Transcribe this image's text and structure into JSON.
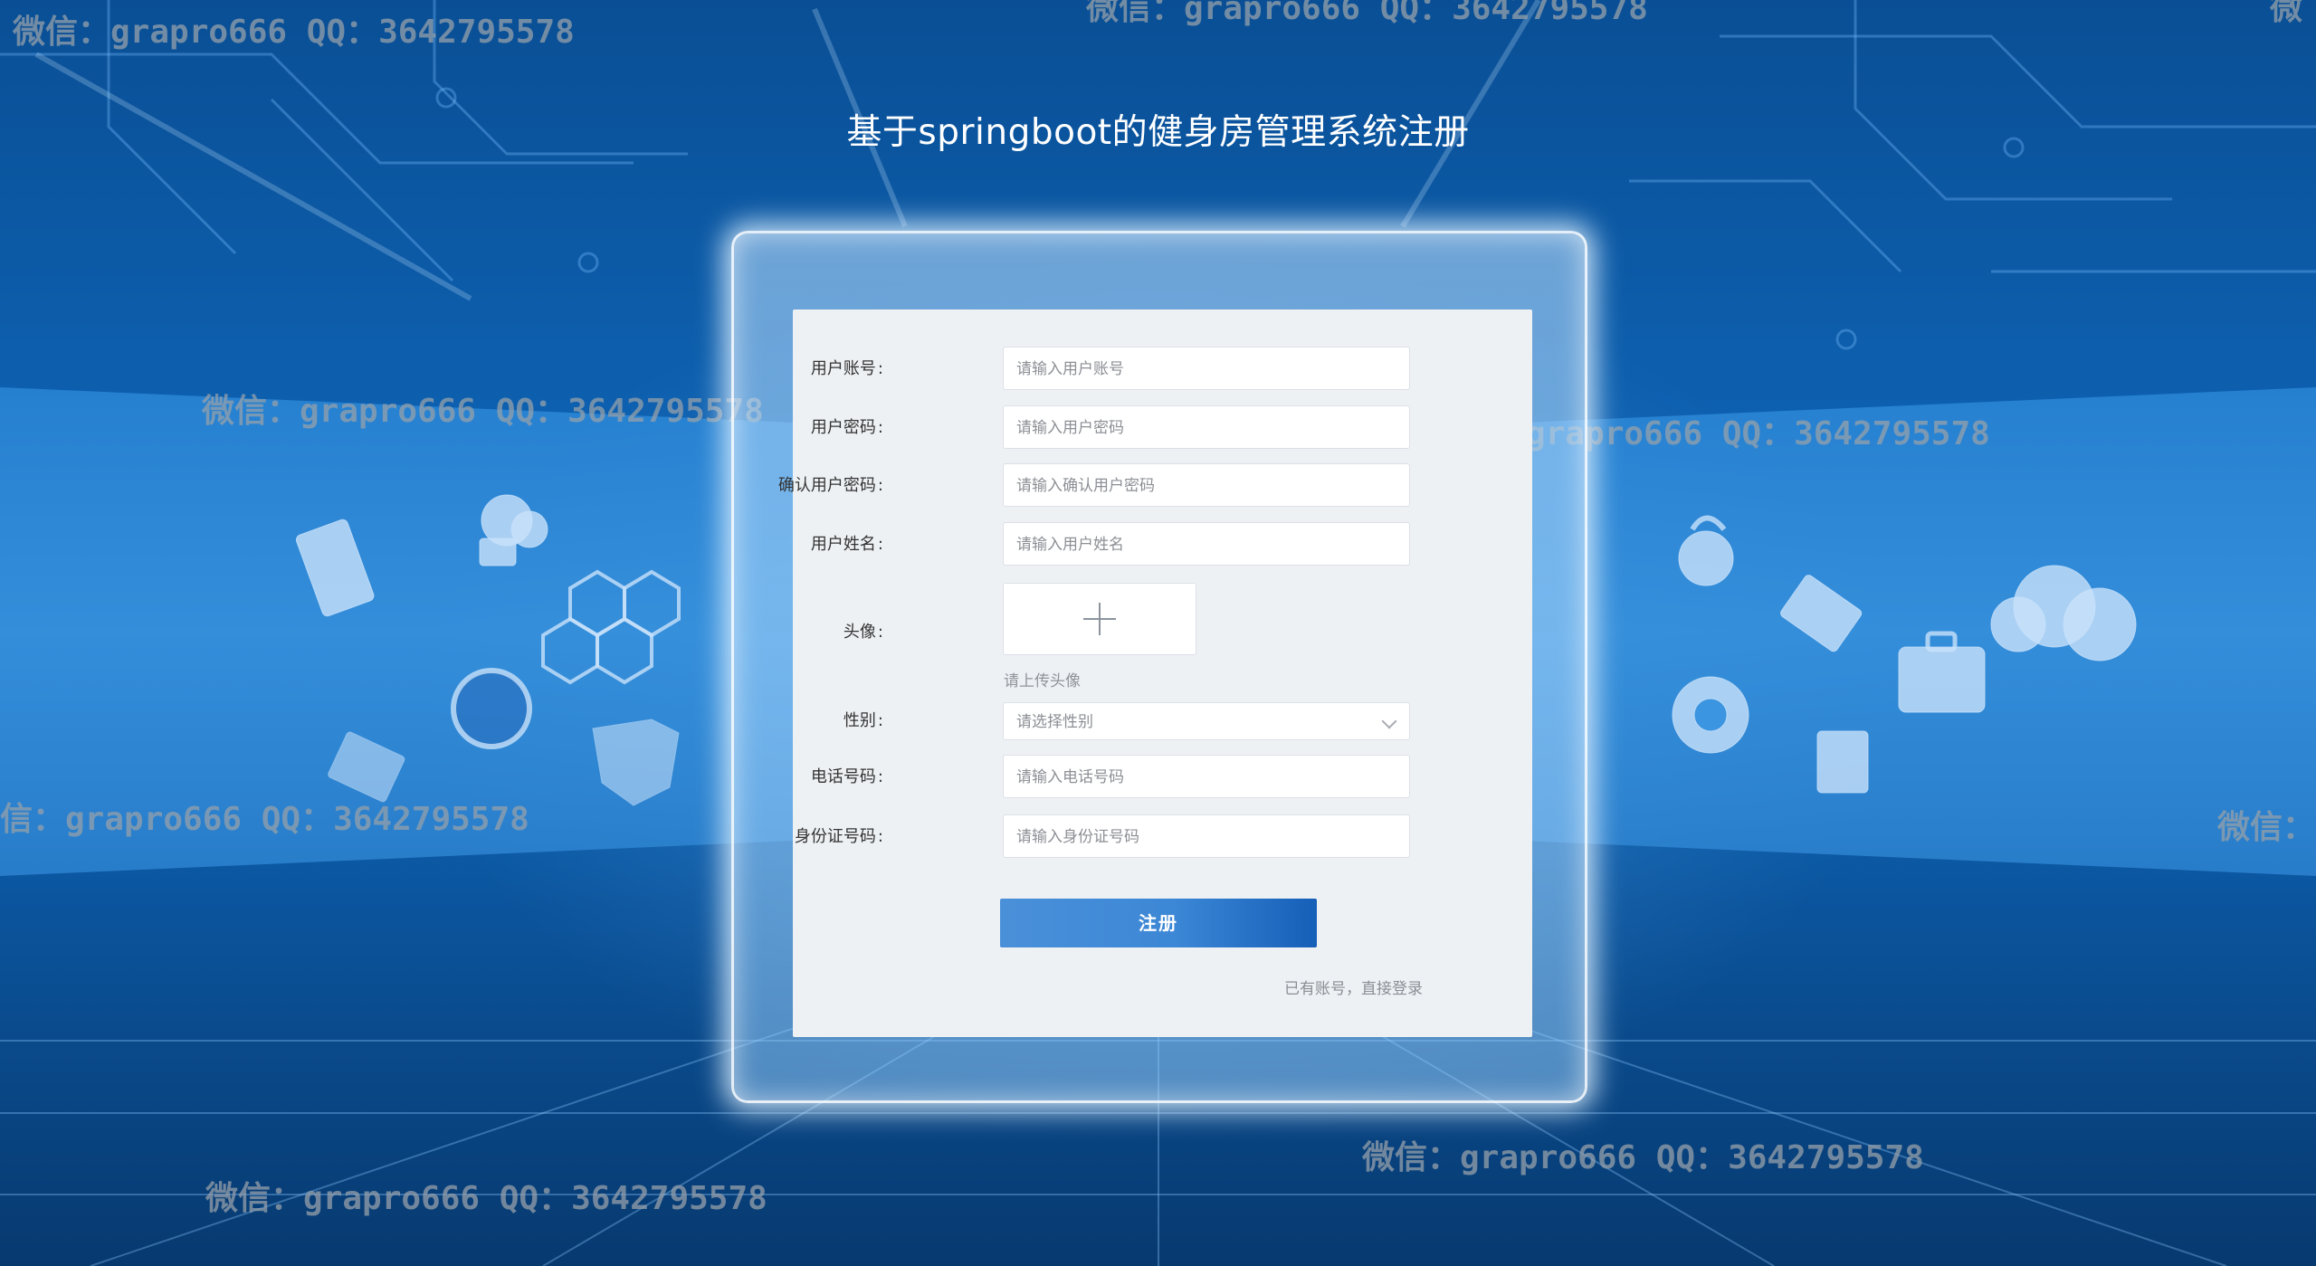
{
  "page": {
    "title": "基于springboot的健身房管理系统注册"
  },
  "form": {
    "fields": [
      {
        "label": "用户账号",
        "placeholder": "请输入用户账号",
        "type": "text"
      },
      {
        "label": "用户密码",
        "placeholder": "请输入用户密码",
        "type": "password"
      },
      {
        "label": "确认用户密码",
        "placeholder": "请输入确认用户密码",
        "type": "password"
      },
      {
        "label": "用户姓名",
        "placeholder": "请输入用户姓名",
        "type": "text"
      },
      {
        "label": "头像",
        "hint": "请上传头像",
        "type": "upload",
        "icon": "plus-icon"
      },
      {
        "label": "性别",
        "placeholder": "请选择性别",
        "type": "select",
        "icon": "chevron-down-icon"
      },
      {
        "label": "电话号码",
        "placeholder": "请输入电话号码",
        "type": "text"
      },
      {
        "label": "身份证号码",
        "placeholder": "请输入身份证号码",
        "type": "text"
      }
    ],
    "submit_label": "注册",
    "login_link": "已有账号，直接登录"
  },
  "watermark": {
    "text": "微信：grapro666 QQ：3642795578",
    "fragment_left": "信：grapro666 QQ：3642795578",
    "fragment_right": "微信：",
    "fragment_top_right": "微"
  },
  "colors": {
    "background": "#0d5fae",
    "button_start": "#4a90d9",
    "button_end": "#155fb8",
    "card": "#eef1f4"
  }
}
